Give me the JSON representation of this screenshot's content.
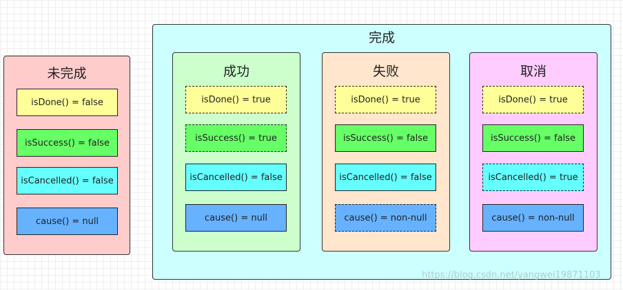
{
  "pending": {
    "title": "未完成",
    "items": [
      "isDone() = false",
      "isSuccess() = false",
      "isCancelled() = false",
      "cause() = null"
    ]
  },
  "done": {
    "title": "完成",
    "success": {
      "title": "成功",
      "items": [
        "isDone() = true",
        "isSuccess() = true",
        "isCancelled() = false",
        "cause() = null"
      ]
    },
    "failure": {
      "title": "失败",
      "items": [
        "isDone() = true",
        "isSuccess() = false",
        "isCancelled() = false",
        "cause() = non-null"
      ]
    },
    "cancelled": {
      "title": "取消",
      "items": [
        "isDone() = true",
        "isSuccess() = false",
        "isCancelled() = true",
        "cause() = non-null"
      ]
    }
  },
  "watermark": "https://blog.csdn.net/yangwei19871103",
  "colors": {
    "pending_bg": "#ffcccc",
    "done_bg": "#ccffff",
    "success_bg": "#ccffcc",
    "failure_bg": "#ffe6cc",
    "cancelled_bg": "#ffccff",
    "isDone": "#ffff99",
    "isSuccess": "#66ff66",
    "isCancelled": "#66ffff",
    "cause": "#66b2ff"
  }
}
